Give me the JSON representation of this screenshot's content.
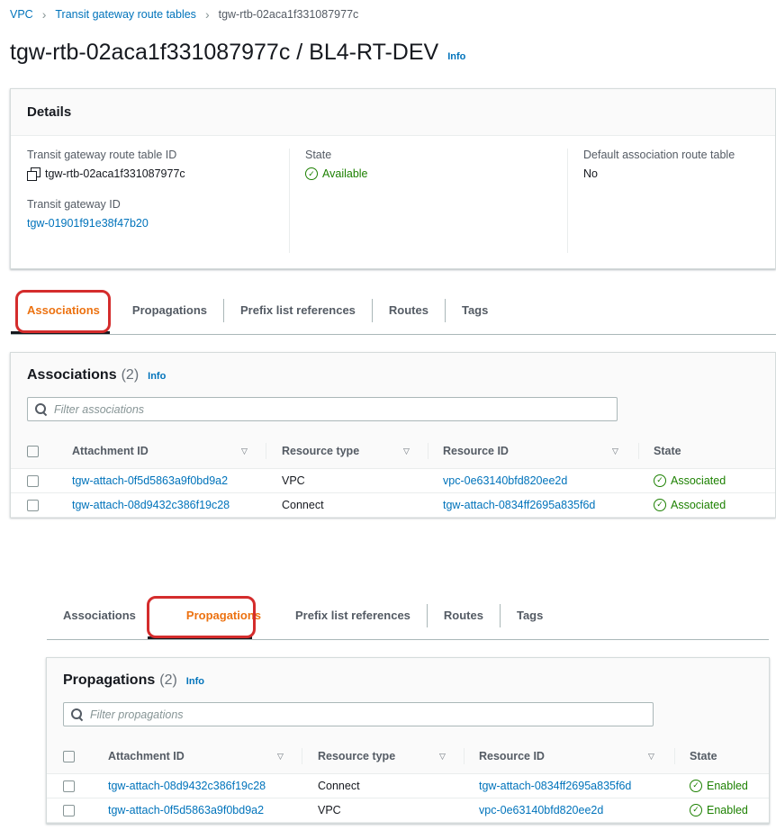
{
  "breadcrumb": {
    "items": [
      "VPC",
      "Transit gateway route tables"
    ],
    "current": "tgw-rtb-02aca1f331087977c"
  },
  "page": {
    "title": "tgw-rtb-02aca1f331087977c / BL4-RT-DEV",
    "info": "Info"
  },
  "details": {
    "heading": "Details",
    "route_table_id_label": "Transit gateway route table ID",
    "route_table_id": "tgw-rtb-02aca1f331087977c",
    "tgw_id_label": "Transit gateway ID",
    "tgw_id": "tgw-01901f91e38f47b20",
    "state_label": "State",
    "state": "Available",
    "default_assoc_label": "Default association route table",
    "default_assoc": "No"
  },
  "tabs": [
    "Associations",
    "Propagations",
    "Prefix list references",
    "Routes",
    "Tags"
  ],
  "associations": {
    "title": "Associations",
    "count": "(2)",
    "info": "Info",
    "filter_placeholder": "Filter associations",
    "columns": [
      "Attachment ID",
      "Resource type",
      "Resource ID",
      "State"
    ],
    "rows": [
      {
        "attachment": "tgw-attach-0f5d5863a9f0bd9a2",
        "type": "VPC",
        "resource": "vpc-0e63140bfd820ee2d",
        "state": "Associated"
      },
      {
        "attachment": "tgw-attach-08d9432c386f19c28",
        "type": "Connect",
        "resource": "tgw-attach-0834ff2695a835f6d",
        "state": "Associated"
      }
    ]
  },
  "propagations": {
    "title": "Propagations",
    "count": "(2)",
    "info": "Info",
    "filter_placeholder": "Filter propagations",
    "columns": [
      "Attachment ID",
      "Resource type",
      "Resource ID",
      "State"
    ],
    "rows": [
      {
        "attachment": "tgw-attach-08d9432c386f19c28",
        "type": "Connect",
        "resource": "tgw-attach-0834ff2695a835f6d",
        "state": "Enabled"
      },
      {
        "attachment": "tgw-attach-0f5d5863a9f0bd9a2",
        "type": "VPC",
        "resource": "vpc-0e63140bfd820ee2d",
        "state": "Enabled"
      }
    ]
  },
  "colors": {
    "link": "#0073bb",
    "active_tab": "#ec7211",
    "success": "#1d8102",
    "highlight": "#d42c2c"
  }
}
